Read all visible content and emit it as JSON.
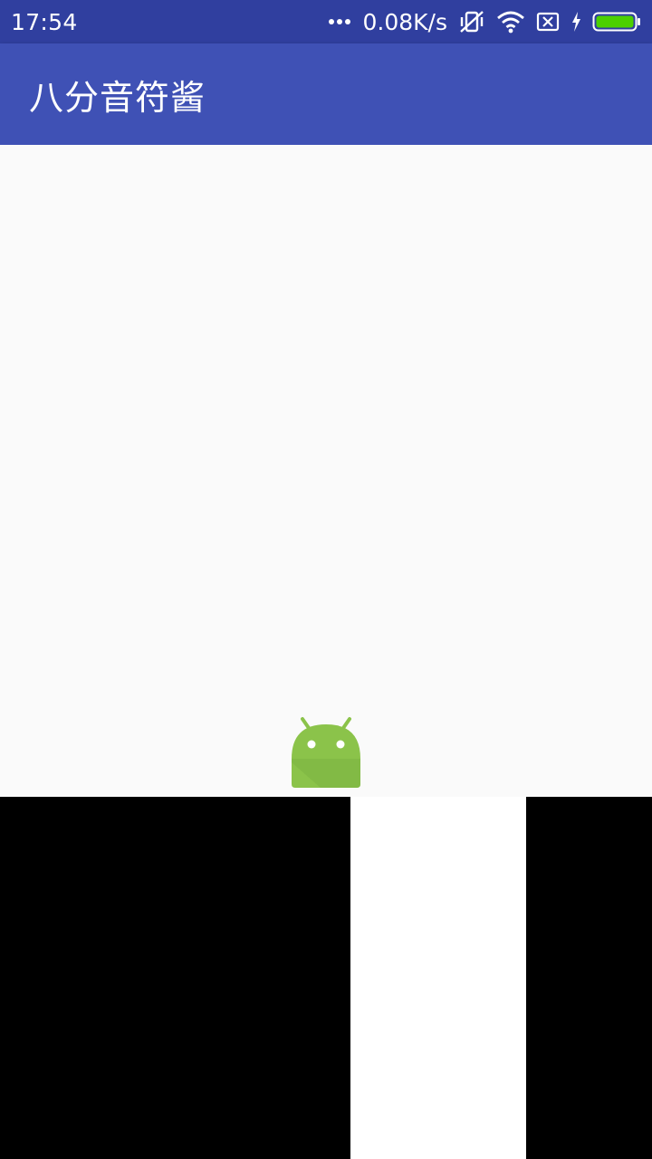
{
  "status_bar": {
    "time": "17:54",
    "network_speed": "0.08K/s",
    "icons": [
      "more-dots-icon",
      "vibrate-off-icon",
      "wifi-icon",
      "sim-disabled-icon",
      "charging-icon",
      "battery-icon"
    ]
  },
  "app_bar": {
    "title": "八分音符酱"
  },
  "content": {
    "avatar_icon": "android-robot-icon",
    "accent_color": "#8bc34a"
  },
  "piano_tiles": [
    {
      "color": "#000000"
    },
    {
      "color": "#ffffff"
    },
    {
      "color": "#000000"
    }
  ],
  "colors": {
    "status_bar": "#303f9f",
    "app_bar": "#3f51b5",
    "background": "#fafafa"
  }
}
